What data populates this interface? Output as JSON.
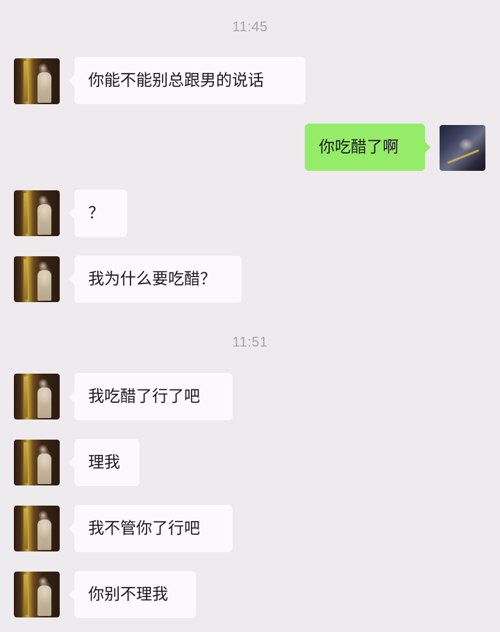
{
  "timestamps": [
    "11:45",
    "11:51"
  ],
  "messages": [
    {
      "side": "left",
      "text": "你能不能别总跟男的说话"
    },
    {
      "side": "right",
      "text": "你吃醋了啊"
    },
    {
      "side": "left",
      "text": "？"
    },
    {
      "side": "left",
      "text": "我为什么要吃醋？"
    },
    {
      "side": "left",
      "text": "我吃醋了行了吧"
    },
    {
      "side": "left",
      "text": "理我"
    },
    {
      "side": "left",
      "text": "我不管你了行吧"
    },
    {
      "side": "left",
      "text": "你别不理我"
    }
  ],
  "colors": {
    "background": "#eeeaee",
    "incoming_bubble": "#fbf9fc",
    "outgoing_bubble": "#95ec69",
    "timestamp_text": "#a6a6a6"
  },
  "icons": {
    "contact_avatar": "contact-avatar-icon",
    "self_avatar": "self-avatar-icon"
  }
}
